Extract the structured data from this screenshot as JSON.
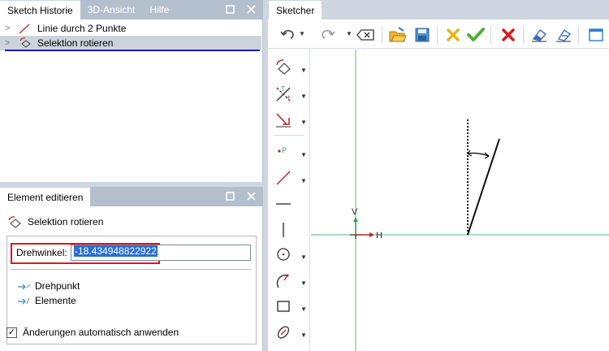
{
  "history": {
    "tabs": [
      {
        "label": "Sketch Historie",
        "active": true
      },
      {
        "label": "3D-Ansicht",
        "active": false
      },
      {
        "label": "Hilfe",
        "active": false
      }
    ],
    "items": [
      {
        "label": "Linie durch 2 Punkte",
        "icon": "line-icon",
        "selected": false
      },
      {
        "label": "Selektion rotieren",
        "icon": "rotate-selection-icon",
        "selected": true
      }
    ]
  },
  "edit": {
    "tab_label": "Element editieren",
    "title": "Selektion rotieren",
    "angle_label": "Drehwinkel:",
    "angle_value": "-18.434948822922",
    "links": [
      "Drehpunkt",
      "Elemente"
    ],
    "auto_apply_label": "Änderungen automatisch anwenden",
    "auto_apply_checked": true
  },
  "sketcher": {
    "tab_label": "Sketcher",
    "axis_h_label": "H",
    "axis_v_label": "V"
  },
  "colors": {
    "accent_red": "#e1141e",
    "selection_blue": "#2a6fd1",
    "axis_green": "#4cc27a"
  }
}
